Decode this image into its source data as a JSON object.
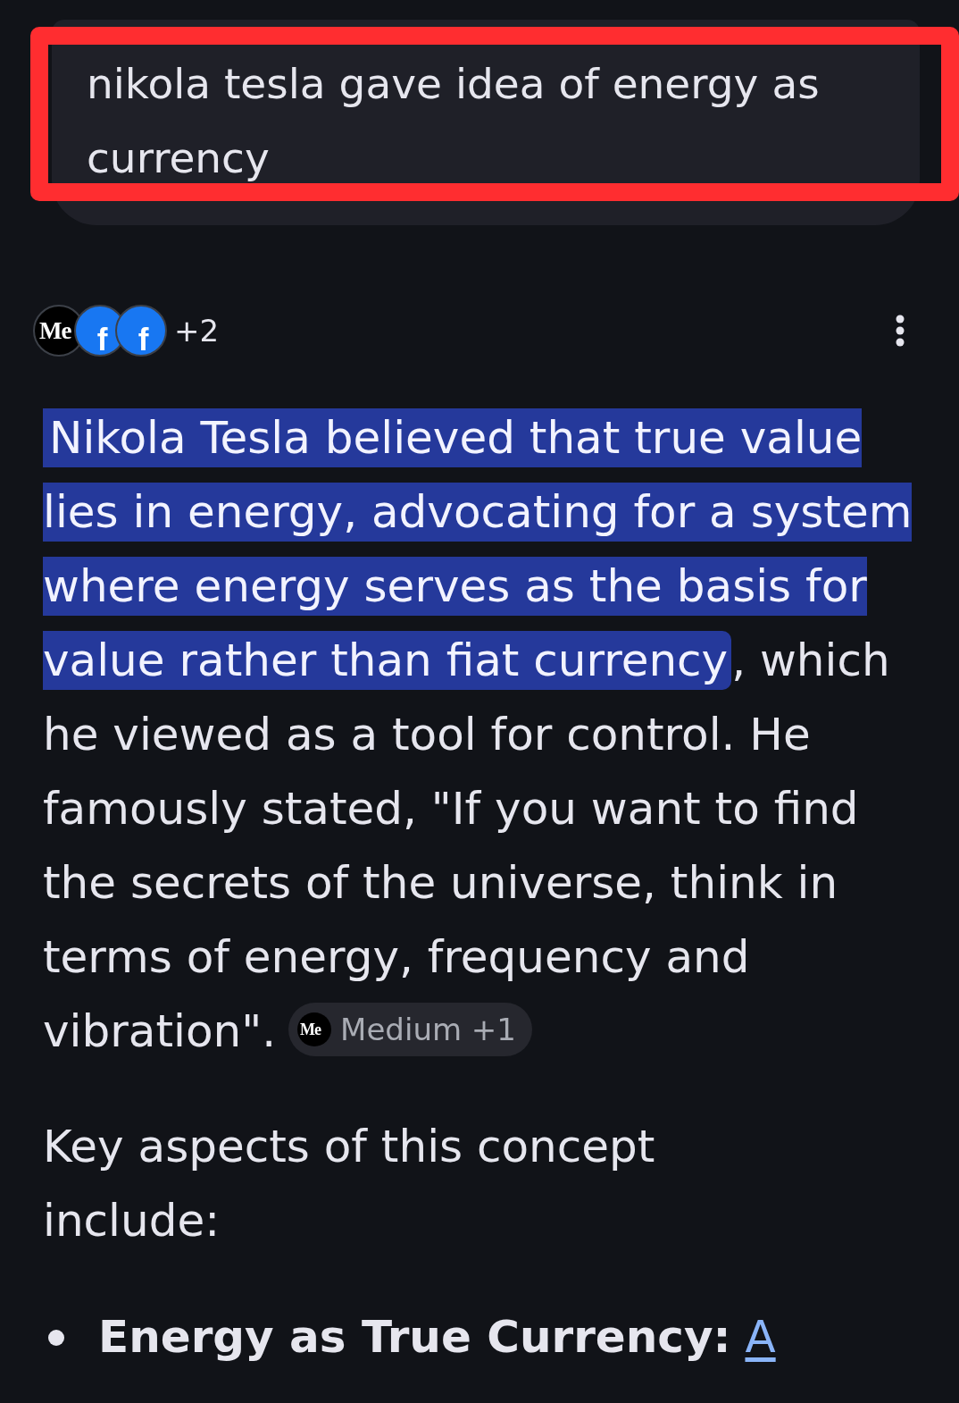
{
  "query": {
    "text": "nikola tesla gave idea of energy as currency",
    "framed": true
  },
  "sources": {
    "logos": [
      {
        "kind": "medium",
        "text": "Me"
      },
      {
        "kind": "facebook",
        "text": "f"
      },
      {
        "kind": "facebook",
        "text": "f"
      }
    ],
    "more_count": "+2"
  },
  "answer": {
    "segments": [
      {
        "text": "Nikola Tesla believed that true value lies in energy, advocating for a system where energy serves as the basis for value rather than fiat currency",
        "highlighted": true
      },
      {
        "text": ", which he viewed as a tool for control. He famously stated, \"If you want to find the secrets of the universe, think in terms of energy, frequency and vibration\".",
        "highlighted": false
      }
    ],
    "citation": {
      "logo": {
        "kind": "medium",
        "text": "Me"
      },
      "label": "Medium +1"
    }
  },
  "intro": "Key aspects of this concept include:",
  "list": [
    {
      "title": "Energy as True Currency:",
      "link": "A"
    }
  ]
}
